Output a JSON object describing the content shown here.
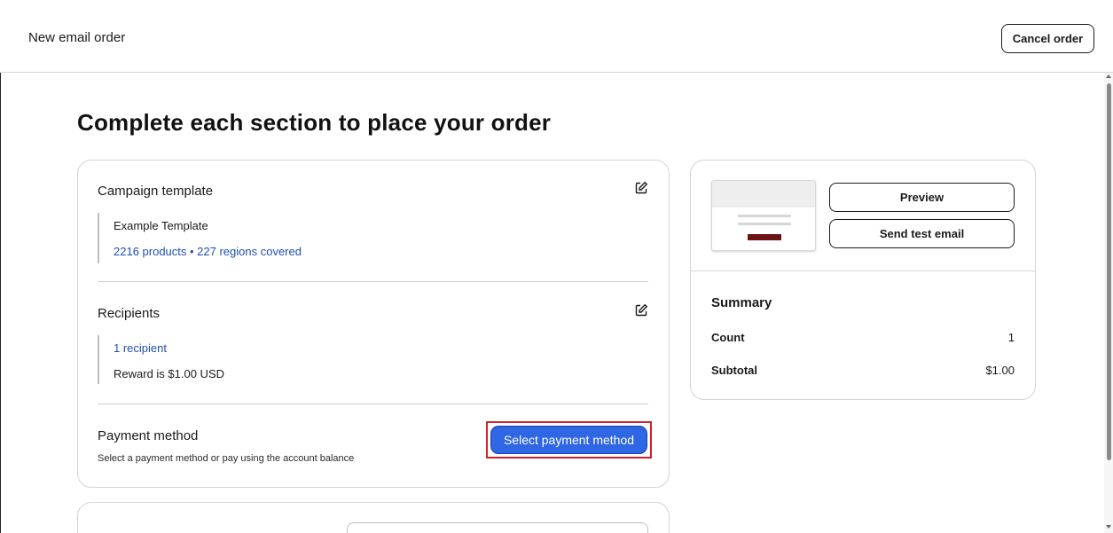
{
  "header": {
    "title": "New email order",
    "cancel_label": "Cancel order"
  },
  "page": {
    "heading": "Complete each section to place your order"
  },
  "campaign": {
    "title": "Campaign template",
    "template_name": "Example Template",
    "coverage": "2216 products • 227 regions covered"
  },
  "recipients": {
    "title": "Recipients",
    "count_link": "1 recipient",
    "reward": "Reward is $1.00 USD"
  },
  "payment": {
    "title": "Payment method",
    "hint": "Select a payment method or pay using the account balance",
    "button_label": "Select payment method"
  },
  "preview": {
    "preview_label": "Preview",
    "send_test_label": "Send test email"
  },
  "summary": {
    "title": "Summary",
    "count_label": "Count",
    "count_value": "1",
    "subtotal_label": "Subtotal",
    "subtotal_value": "$1.00"
  },
  "icons": {
    "edit": "edit-icon",
    "scroll_up": "scroll-up-arrow",
    "scroll_down": "scroll-down-arrow"
  },
  "colors": {
    "accent": "#2f66e3",
    "link": "#1f4fb4",
    "highlight": "#d0202a"
  }
}
